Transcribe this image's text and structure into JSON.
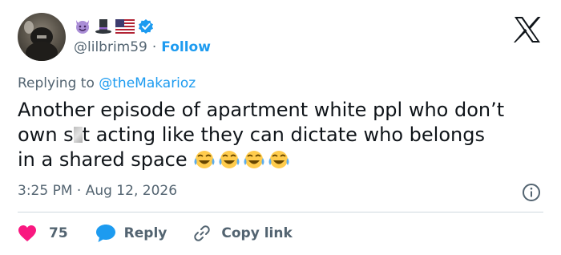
{
  "tweet": {
    "handle": "@lilbrim59",
    "dot": "·",
    "follow_label": "Follow",
    "replying_prefix": "Replying to",
    "replying_to": "@theMakarioz",
    "text_lines": [
      "Another episode of apartment white ppl who don’t",
      {
        "before": "own s",
        "after": "t acting like they can dictate who belongs"
      },
      "in a shared space"
    ],
    "timestamp": "3:25 PM · Aug 12, 2026",
    "likes": "75",
    "reply_label": "Reply",
    "copy_label": "Copy link"
  },
  "icons": {
    "badges": [
      "smiling-devil-icon",
      "top-hat-icon",
      "us-flag-icon",
      "verified-badge-icon"
    ],
    "brand": "x-logo-icon",
    "info": "info-icon",
    "like": "heart-icon",
    "reply": "speech-bubble-icon",
    "copy": "link-icon",
    "laugh": "tears-of-joy-icon"
  },
  "colors": {
    "accent": "#1d9bf0",
    "like": "#f91880",
    "text": "#0f1419",
    "muted": "#536471"
  }
}
